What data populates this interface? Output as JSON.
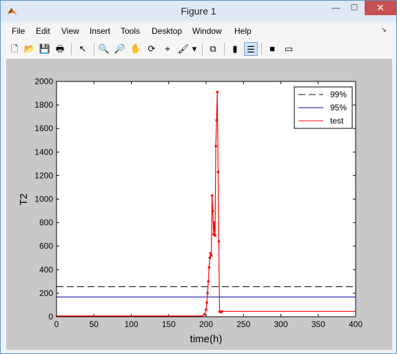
{
  "window": {
    "title": "Figure 1",
    "minimize": "—",
    "maximize": "☐",
    "close": "✕"
  },
  "menu": [
    "File",
    "Edit",
    "View",
    "Insert",
    "Tools",
    "Desktop",
    "Window",
    "Help"
  ],
  "toolbar": [
    {
      "name": "new-figure-icon",
      "glyph": "🗋"
    },
    {
      "name": "open-file-icon",
      "glyph": "📂"
    },
    {
      "name": "save-icon",
      "glyph": "💾"
    },
    {
      "name": "print-icon",
      "glyph": "🖶"
    },
    {
      "name": "pointer-icon",
      "glyph": "↖"
    },
    {
      "name": "zoom-in-icon",
      "glyph": "🔍"
    },
    {
      "name": "zoom-out-icon",
      "glyph": "🔎"
    },
    {
      "name": "pan-icon",
      "glyph": "✋"
    },
    {
      "name": "rotate-3d-icon",
      "glyph": "⟳"
    },
    {
      "name": "data-cursor-icon",
      "glyph": "⌖"
    },
    {
      "name": "brush-icon",
      "glyph": "🖌"
    },
    {
      "name": "brush-dropdown-icon",
      "glyph": "▾"
    },
    {
      "name": "link-plot-icon",
      "glyph": "⧉"
    },
    {
      "name": "colorbar-icon",
      "glyph": "▮"
    },
    {
      "name": "legend-icon",
      "glyph": "☰"
    },
    {
      "name": "hide-plot-tools-icon",
      "glyph": "■"
    },
    {
      "name": "show-plot-tools-icon",
      "glyph": "▭"
    }
  ],
  "colors": {
    "threshold99": "#000000",
    "threshold95": "#0000a0",
    "test": "#ff0000"
  },
  "chart_data": {
    "type": "line",
    "title": "",
    "xlabel": "time(h)",
    "ylabel": "T2",
    "xlim": [
      0,
      400
    ],
    "ylim": [
      0,
      2000
    ],
    "xticks": [
      0,
      50,
      100,
      150,
      200,
      250,
      300,
      350,
      400
    ],
    "yticks": [
      0,
      200,
      400,
      600,
      800,
      1000,
      1200,
      1400,
      1600,
      1800,
      2000
    ],
    "legend_position": "top-right",
    "series": [
      {
        "name": "99%",
        "style": "dashed",
        "color": "#000000",
        "x": [
          0,
          400
        ],
        "y": [
          255,
          255
        ]
      },
      {
        "name": "95%",
        "style": "solid",
        "color": "#0000a0",
        "x": [
          0,
          400
        ],
        "y": [
          168,
          168
        ]
      },
      {
        "name": "test",
        "style": "solid-markers",
        "color": "#ff0000",
        "x": [
          0,
          195,
          198,
          200,
          201,
          202,
          203,
          204,
          205,
          206,
          207,
          208,
          209,
          210,
          211,
          212,
          213,
          214,
          215,
          216,
          217,
          218,
          219,
          220,
          221,
          225,
          400
        ],
        "y": [
          5,
          5,
          20,
          60,
          120,
          200,
          300,
          420,
          500,
          540,
          520,
          1030,
          900,
          700,
          800,
          690,
          1450,
          1670,
          1910,
          1230,
          640,
          45,
          40,
          40,
          45,
          45,
          45
        ]
      }
    ]
  }
}
